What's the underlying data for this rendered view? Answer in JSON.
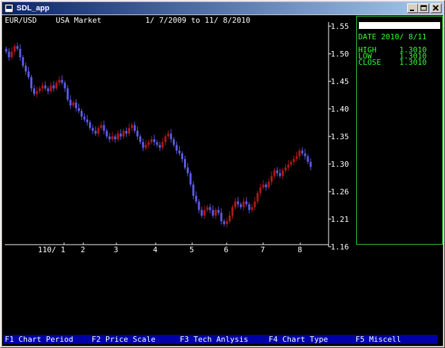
{
  "window": {
    "title": "SDL_app"
  },
  "header": {
    "symbol": "EUR/USD",
    "market": "USA Market",
    "date_range": "1/ 7/2009 to 11/ 8/2010"
  },
  "info": {
    "date": "DATE 2010/ 8/11",
    "high": "HIGH     1.3010",
    "low": "LOW      1.3010",
    "close": "CLOSE    1.3010"
  },
  "fkeys": [
    {
      "label": "F1 Chart Period"
    },
    {
      "label": "F2 Price Scale"
    },
    {
      "label": "F3 Tech Anlysis"
    },
    {
      "label": "F4 Chart Type"
    },
    {
      "label": "F5 Miscell"
    }
  ],
  "colors": {
    "up": "#b01818",
    "down": "#5a5ae6",
    "axis": "#ffffff",
    "info": "#33ff33",
    "fkey_bg": "#0000a8"
  },
  "chart_data": {
    "type": "candlestick",
    "ylim": [
      1.16,
      1.56
    ],
    "y_ticks": [
      "1.55",
      "1.50",
      "1.45",
      "1.40",
      "1.35",
      "1.30",
      "1.26",
      "1.21",
      "1.16"
    ],
    "x_labels": [
      "110/ 1",
      "2",
      "3",
      "4",
      "5",
      "6",
      "7",
      "8"
    ],
    "closes": [
      1.505,
      1.495,
      1.505,
      1.515,
      1.51,
      1.495,
      1.48,
      1.47,
      1.46,
      1.44,
      1.43,
      1.435,
      1.44,
      1.445,
      1.44,
      1.435,
      1.445,
      1.44,
      1.45,
      1.455,
      1.45,
      1.44,
      1.42,
      1.41,
      1.415,
      1.405,
      1.4,
      1.39,
      1.385,
      1.38,
      1.37,
      1.365,
      1.36,
      1.37,
      1.375,
      1.365,
      1.355,
      1.35,
      1.355,
      1.35,
      1.36,
      1.355,
      1.365,
      1.36,
      1.37,
      1.375,
      1.365,
      1.355,
      1.345,
      1.335,
      1.34,
      1.345,
      1.35,
      1.345,
      1.34,
      1.335,
      1.345,
      1.355,
      1.36,
      1.35,
      1.34,
      1.33,
      1.325,
      1.315,
      1.3,
      1.29,
      1.27,
      1.25,
      1.24,
      1.225,
      1.215,
      1.225,
      1.23,
      1.225,
      1.215,
      1.225,
      1.22,
      1.205,
      1.2,
      1.205,
      1.215,
      1.23,
      1.24,
      1.235,
      1.23,
      1.24,
      1.235,
      1.225,
      1.23,
      1.24,
      1.255,
      1.265,
      1.27,
      1.265,
      1.275,
      1.285,
      1.295,
      1.29,
      1.285,
      1.295,
      1.3,
      1.305,
      1.31,
      1.315,
      1.32,
      1.33,
      1.325,
      1.32,
      1.31,
      1.301
    ]
  }
}
